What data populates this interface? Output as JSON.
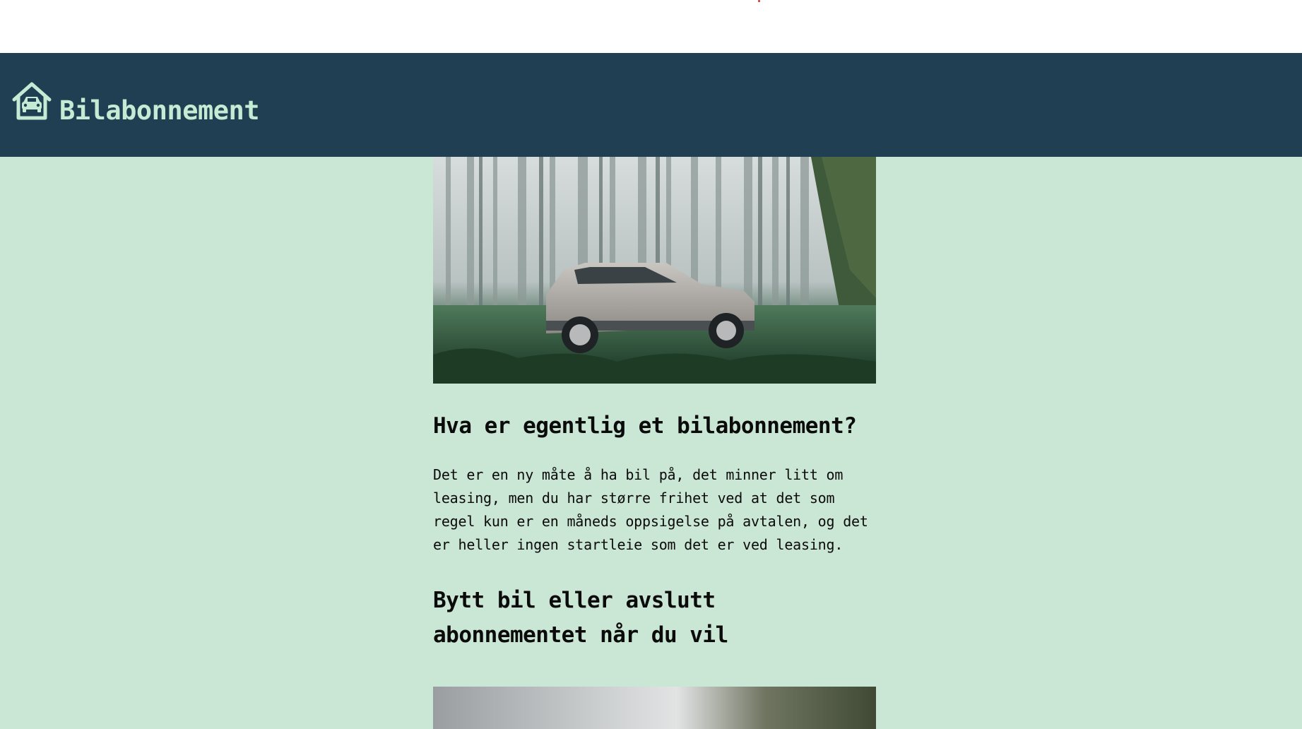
{
  "header": {
    "site_title": "Bilabonnement",
    "logo_icon": "car-garage-icon"
  },
  "hero_image": {
    "alt": "Sølvgrå SUV i tåkete skog"
  },
  "sections": [
    {
      "heading": "Hva er egentlig et bilabonnement?",
      "body": "Det er en ny måte å ha bil på, det minner litt om leasing, men du har større frihet ved at det som regel kun er en måneds oppsigelse på avtalen, og det er heller ingen startleie som det er ved leasing."
    },
    {
      "heading": "Bytt bil eller avslutt abonnementet når du vil"
    }
  ],
  "colors": {
    "page_background": "#cae6d5",
    "header_background": "#213f53",
    "header_text": "#c4ebd4",
    "body_text": "#0b0b0b"
  }
}
